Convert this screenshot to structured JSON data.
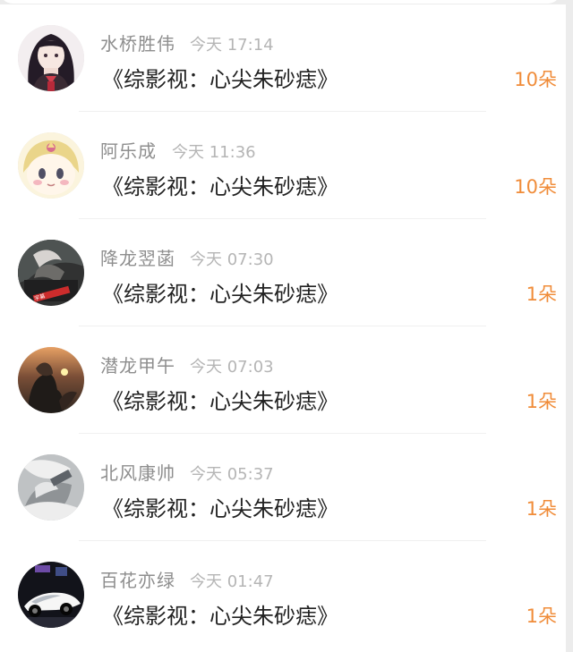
{
  "items": [
    {
      "name": "水桥胜伟",
      "time": "今天 17:14",
      "title": "《综影视：心尖朱砂痣》",
      "count": "10朵",
      "avatar_kind": "dark-hair-doll"
    },
    {
      "name": "阿乐成",
      "time": "今天 11:36",
      "title": "《综影视：心尖朱砂痣》",
      "count": "10朵",
      "avatar_kind": "blonde-cartoon-face"
    },
    {
      "name": "降龙翌菡",
      "time": "今天 07:30",
      "title": "《综影视：心尖朱砂痣》",
      "count": "1朵",
      "avatar_kind": "dark-photo-with-red-text"
    },
    {
      "name": "潜龙甲午",
      "time": "今天 07:03",
      "title": "《综影视：心尖朱砂痣》",
      "count": "1朵",
      "avatar_kind": "sunset-photo"
    },
    {
      "name": "北风康帅",
      "time": "今天 05:37",
      "title": "《综影视：心尖朱砂痣》",
      "count": "1朵",
      "avatar_kind": "grey-photo"
    },
    {
      "name": "百花亦绿",
      "time": "今天 01:47",
      "title": "《综影视：心尖朱砂痣》",
      "count": "1朵",
      "avatar_kind": "white-sports-car"
    }
  ],
  "colors": {
    "accent_count": "#f08c39",
    "name_text": "#8e8e8e",
    "time_text": "#b5b5b5",
    "title_text": "#222222"
  }
}
